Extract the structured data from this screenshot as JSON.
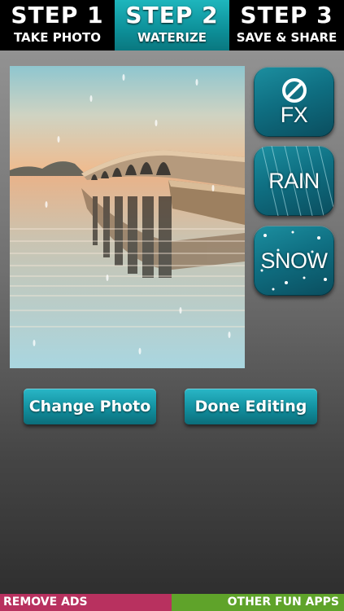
{
  "steps": [
    {
      "number": "STEP 1",
      "label": "TAKE PHOTO",
      "active": false
    },
    {
      "number": "STEP 2",
      "label": "WATERIZE",
      "active": true
    },
    {
      "number": "STEP 3",
      "label": "SAVE & SHARE",
      "active": false
    }
  ],
  "effects": {
    "fx": {
      "label": "FX",
      "icon": "no-effect-icon"
    },
    "rain": {
      "label": "RAIN",
      "icon": "rain-streaks"
    },
    "snow": {
      "label": "SNOW",
      "icon": "snowflakes"
    }
  },
  "actions": {
    "change_photo": "Change Photo",
    "done_editing": "Done Editing"
  },
  "footer": {
    "remove_ads": "REMOVE ADS",
    "other_apps": "OTHER FUN APPS"
  },
  "colors": {
    "active_step": "#1eb6bd",
    "button_teal": "#12909f",
    "footer_left": "#b8315f",
    "footer_right": "#5fa32a"
  }
}
